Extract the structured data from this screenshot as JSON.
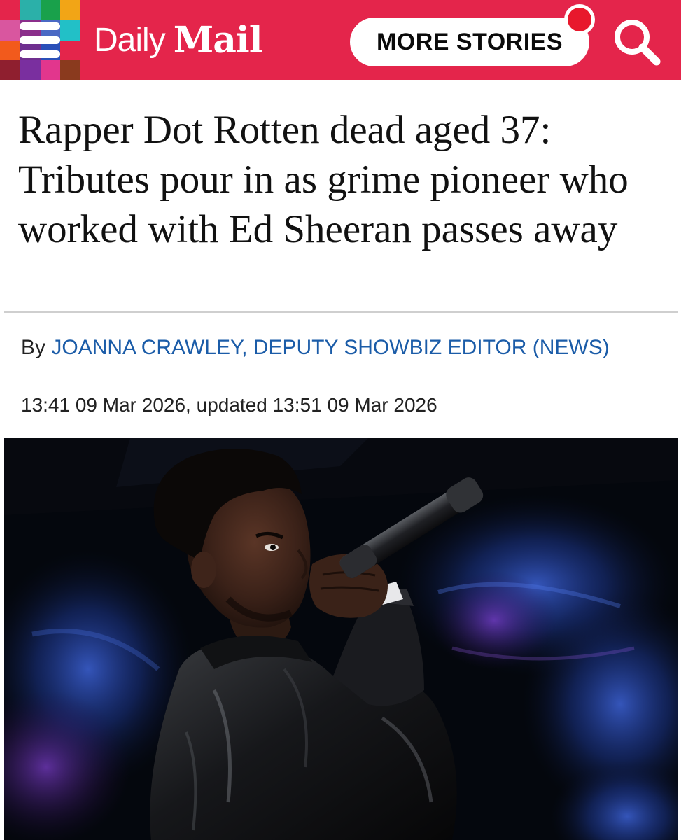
{
  "header": {
    "brand_daily": "Daily",
    "brand_mail": "Mail",
    "more_stories_label": "MORE STORIES",
    "menu_icon": "hamburger-menu-icon",
    "search_icon": "search-icon",
    "brand_color": "#e4254b",
    "notification_color": "#e8182c"
  },
  "article": {
    "headline": "Rapper Dot Rotten dead aged 37: Tributes pour in as grime pioneer who worked with Ed Sheeran passes away",
    "byline_prefix": "By ",
    "author": "JOANNA CRAWLEY, DEPUTY SHOWBIZ EDITOR (NEWS)",
    "dateline": "13:41 09 Mar 2026, updated 13:51 09 Mar 2026",
    "author_color": "#1b5ca8"
  }
}
